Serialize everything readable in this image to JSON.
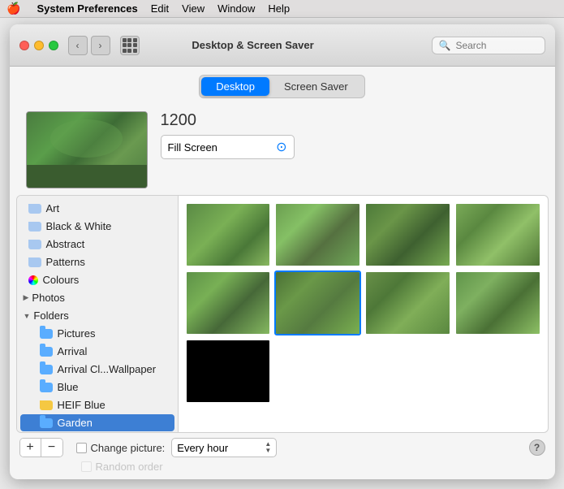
{
  "menubar": {
    "apple": "🍎",
    "app_name": "System Preferences",
    "items": [
      "Edit",
      "View",
      "Window",
      "Help"
    ]
  },
  "titlebar": {
    "title": "Desktop & Screen Saver",
    "search_placeholder": "Search"
  },
  "tabs": {
    "desktop": "Desktop",
    "screen_saver": "Screen Saver",
    "active": "desktop"
  },
  "preview": {
    "number": "1200",
    "fill_option": "Fill Screen"
  },
  "sidebar": {
    "items": [
      {
        "id": "art",
        "label": "Art",
        "type": "folder"
      },
      {
        "id": "black-white",
        "label": "Black & White",
        "type": "folder"
      },
      {
        "id": "abstract",
        "label": "Abstract",
        "type": "folder"
      },
      {
        "id": "patterns",
        "label": "Patterns",
        "type": "folder"
      },
      {
        "id": "colours",
        "label": "Colours",
        "type": "color"
      }
    ],
    "photos_label": "Photos",
    "folders_label": "Folders",
    "folders_items": [
      {
        "id": "pictures",
        "label": "Pictures",
        "type": "folder-blue"
      },
      {
        "id": "arrival",
        "label": "Arrival",
        "type": "folder-blue"
      },
      {
        "id": "arrival-cl",
        "label": "Arrival Cl...Wallpaper",
        "type": "folder-blue"
      },
      {
        "id": "blue",
        "label": "Blue",
        "type": "folder-blue"
      },
      {
        "id": "heif-blue",
        "label": "HEIF Blue",
        "type": "folder-blue"
      },
      {
        "id": "garden",
        "label": "Garden",
        "type": "folder-blue",
        "selected": true
      }
    ]
  },
  "thumbnails": [
    {
      "id": "t1",
      "class": "garden-thumb-1",
      "selected": false
    },
    {
      "id": "t2",
      "class": "garden-thumb-2",
      "selected": false
    },
    {
      "id": "t3",
      "class": "garden-thumb-3",
      "selected": false
    },
    {
      "id": "t4",
      "class": "garden-thumb-4",
      "selected": false
    },
    {
      "id": "t5",
      "class": "garden-thumb-5",
      "selected": false
    },
    {
      "id": "t6",
      "class": "garden-thumb-6",
      "selected": true
    },
    {
      "id": "t7",
      "class": "garden-thumb-7",
      "selected": false
    },
    {
      "id": "t8",
      "class": "garden-thumb-8",
      "selected": false
    },
    {
      "id": "t9",
      "class": "thumb-black",
      "selected": false
    }
  ],
  "bottom": {
    "add_btn": "+",
    "remove_btn": "−",
    "change_picture_label": "Change picture:",
    "interval_value": "Every hour",
    "random_order_label": "Random order",
    "help_symbol": "?"
  }
}
